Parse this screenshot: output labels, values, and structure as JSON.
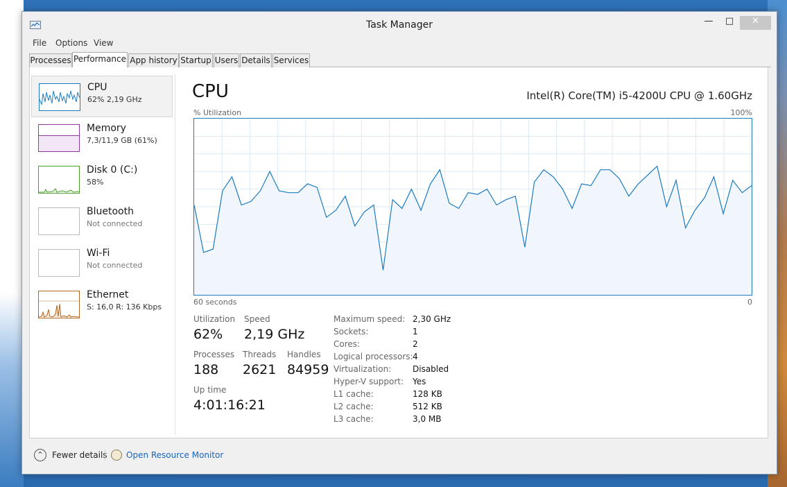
{
  "window": {
    "title": "Task Manager"
  },
  "menu": [
    "File",
    "Options",
    "View"
  ],
  "tabs": [
    "Processes",
    "Performance",
    "App history",
    "Startup",
    "Users",
    "Details",
    "Services"
  ],
  "sidebar": [
    {
      "title": "CPU",
      "sub": "62%  2,19 GHz"
    },
    {
      "title": "Memory",
      "sub": "7,3/11,9 GB (61%)"
    },
    {
      "title": "Disk 0 (C:)",
      "sub": "58%"
    },
    {
      "title": "Bluetooth",
      "sub": "Not connected"
    },
    {
      "title": "Wi-Fi",
      "sub": "Not connected"
    },
    {
      "title": "Ethernet",
      "sub": "S: 16,0  R: 136 Kbps"
    }
  ],
  "panel": {
    "title": "CPU",
    "model": "Intel(R) Core(TM) i5-4200U CPU @ 1.60GHz",
    "y_label": "% Utilization",
    "y_max": "100%",
    "x_left": "60 seconds",
    "x_right": "0"
  },
  "stats": {
    "utilization_label": "Utilization",
    "utilization": "62%",
    "speed_label": "Speed",
    "speed": "2,19 GHz",
    "processes_label": "Processes",
    "processes": "188",
    "threads_label": "Threads",
    "threads": "2621",
    "handles_label": "Handles",
    "handles": "84959",
    "uptime_label": "Up time",
    "uptime": "4:01:16:21"
  },
  "specs": [
    {
      "label": "Maximum speed:",
      "value": "2,30 GHz"
    },
    {
      "label": "Sockets:",
      "value": "1"
    },
    {
      "label": "Cores:",
      "value": "2"
    },
    {
      "label": "Logical processors:",
      "value": "4"
    },
    {
      "label": "Virtualization:",
      "value": "Disabled"
    },
    {
      "label": "Hyper-V support:",
      "value": "Yes"
    },
    {
      "label": "L1 cache:",
      "value": "128 KB"
    },
    {
      "label": "L2 cache:",
      "value": "512 KB"
    },
    {
      "label": "L3 cache:",
      "value": "3,0 MB"
    }
  ],
  "footer": {
    "fewer": "Fewer details",
    "resmon": "Open Resource Monitor"
  },
  "cpu_history": [
    51,
    24,
    26,
    59,
    67,
    51,
    53,
    59,
    70,
    59,
    58,
    58,
    63,
    61,
    44,
    48,
    56,
    39,
    47,
    51,
    14,
    54,
    49,
    60,
    48,
    63,
    71,
    52,
    49,
    58,
    57,
    60,
    51,
    54,
    56,
    27,
    64,
    71,
    67,
    60,
    49,
    63,
    62,
    71,
    71,
    66,
    56,
    63,
    68,
    73,
    50,
    65,
    38,
    48,
    55,
    67,
    46,
    65,
    58,
    62
  ],
  "colors": {
    "accent": "#1c7bbf",
    "fill": "#f0f6fc",
    "grid": "#dceaf6"
  }
}
